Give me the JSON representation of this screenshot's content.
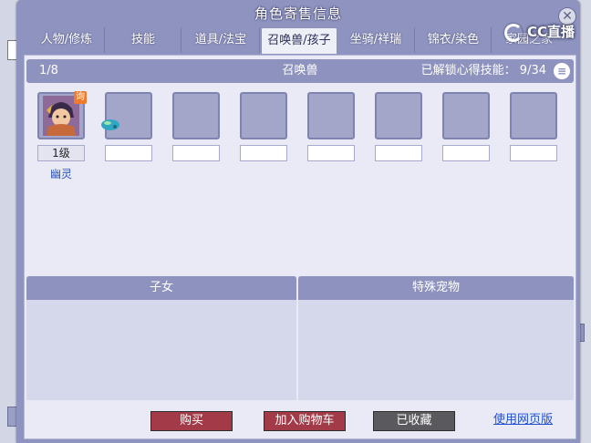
{
  "window": {
    "title": "角色寄售信息"
  },
  "tabs": [
    {
      "label": "人物/修炼"
    },
    {
      "label": "技能"
    },
    {
      "label": "道具/法宝"
    },
    {
      "label": "召唤兽/孩子"
    },
    {
      "label": "坐骑/祥瑞"
    },
    {
      "label": "锦衣/染色"
    },
    {
      "label": "家园之家"
    }
  ],
  "active_tab_index": 3,
  "logo": {
    "text": "CC直播"
  },
  "header": {
    "page": "1/8",
    "title": "召唤兽",
    "unlock_label": "已解锁心得技能：",
    "unlock_value": "9/34"
  },
  "pets": [
    {
      "level": "1级",
      "name": "幽灵",
      "badge": "询"
    }
  ],
  "sections": {
    "children": "子女",
    "special_pets": "特殊宠物"
  },
  "buttons": {
    "buy": "购买",
    "add_cart": "加入购物车",
    "favorited": "已收藏",
    "web_version": "使用网页版"
  },
  "colors": {
    "buy": "#a23a47",
    "add_cart": "#a23a47",
    "favorited": "#5a5a5e",
    "link": "#1f4fd0",
    "header": "#8e92be"
  }
}
